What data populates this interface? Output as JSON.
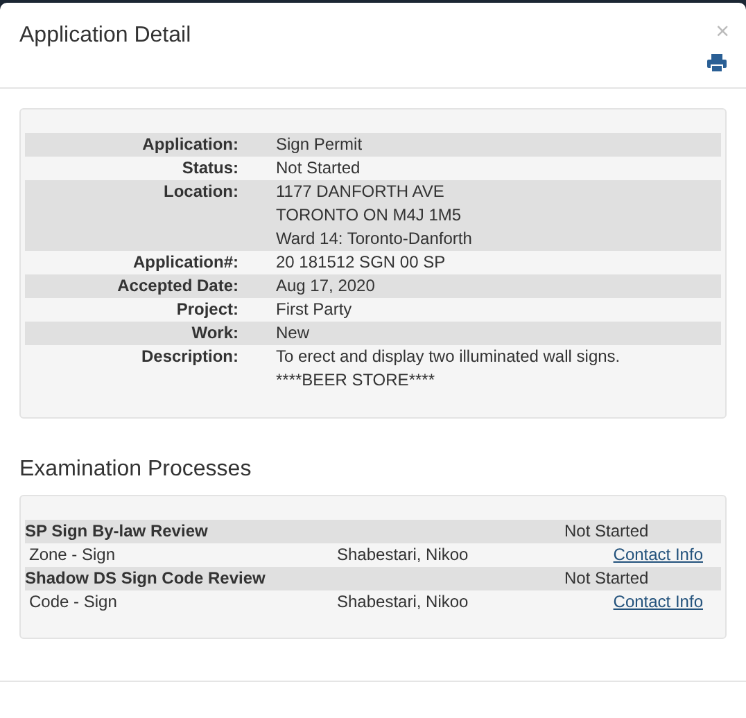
{
  "dialog": {
    "title": "Application Detail",
    "close": "×"
  },
  "details": [
    {
      "label": "Application:",
      "lines": [
        "Sign Permit"
      ]
    },
    {
      "label": "Status:",
      "lines": [
        "Not Started"
      ]
    },
    {
      "label": "Location:",
      "lines": [
        "1177 DANFORTH AVE",
        "TORONTO ON M4J 1M5",
        "Ward 14: Toronto-Danforth"
      ]
    },
    {
      "label": "Application#:",
      "lines": [
        "20 181512 SGN 00 SP"
      ]
    },
    {
      "label": "Accepted Date:",
      "lines": [
        "Aug 17, 2020"
      ]
    },
    {
      "label": "Project:",
      "lines": [
        "First Party"
      ]
    },
    {
      "label": "Work:",
      "lines": [
        "New"
      ]
    },
    {
      "label": "Description:",
      "lines": [
        "To erect and display two illuminated wall signs.",
        "****BEER STORE****"
      ]
    }
  ],
  "examination": {
    "heading": "Examination Processes",
    "processes": [
      {
        "name": "SP Sign By-law Review",
        "status": "Not Started",
        "tasks": [
          {
            "name": "Zone - Sign",
            "assignee": "Shabestari, Nikoo",
            "link": "Contact Info"
          }
        ]
      },
      {
        "name": "Shadow DS Sign Code Review",
        "status": "Not Started",
        "tasks": [
          {
            "name": "Code - Sign",
            "assignee": "Shabestari, Nikoo",
            "link": "Contact Info"
          }
        ]
      }
    ]
  }
}
